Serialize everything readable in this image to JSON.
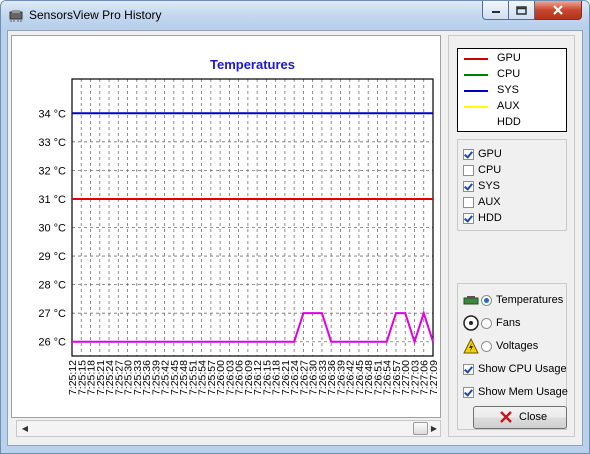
{
  "window": {
    "title": "SensorsView Pro History"
  },
  "chart_data": {
    "type": "line",
    "title": "Temperatures",
    "ylim": [
      25.5,
      35.2
    ],
    "y_ticks": [
      "26 °C",
      "27 °C",
      "28 °C",
      "29 °C",
      "30 °C",
      "31 °C",
      "32 °C",
      "33 °C",
      "34 °C"
    ],
    "y_tick_values": [
      26,
      27,
      28,
      29,
      30,
      31,
      32,
      33,
      34
    ],
    "x_categories": [
      "7:25:12",
      "7:25:15",
      "7:25:18",
      "7:25:21",
      "7:25:24",
      "7:25:27",
      "7:25:30",
      "7:25:33",
      "7:25:36",
      "7:25:39",
      "7:25:42",
      "7:25:45",
      "7:25:48",
      "7:25:51",
      "7:25:54",
      "7:25:57",
      "7:26:00",
      "7:26:03",
      "7:26:06",
      "7:26:09",
      "7:26:12",
      "7:26:15",
      "7:26:18",
      "7:26:21",
      "7:26:24",
      "7:26:27",
      "7:26:30",
      "7:26:33",
      "7:26:36",
      "7:26:39",
      "7:26:42",
      "7:26:45",
      "7:26:48",
      "7:26:51",
      "7:26:54",
      "7:26:57",
      "7:27:00",
      "7:27:03",
      "7:27:06",
      "7:27:09"
    ],
    "grid": true,
    "series": [
      {
        "name": "SYS",
        "color": "#0000c0",
        "values": [
          34,
          34,
          34,
          34,
          34,
          34,
          34,
          34,
          34,
          34,
          34,
          34,
          34,
          34,
          34,
          34,
          34,
          34,
          34,
          34,
          34,
          34,
          34,
          34,
          34,
          34,
          34,
          34,
          34,
          34,
          34,
          34,
          34,
          34,
          34,
          34,
          34,
          34,
          34,
          34
        ]
      },
      {
        "name": "GPU",
        "color": "#e00000",
        "values": [
          31,
          31,
          31,
          31,
          31,
          31,
          31,
          31,
          31,
          31,
          31,
          31,
          31,
          31,
          31,
          31,
          31,
          31,
          31,
          31,
          31,
          31,
          31,
          31,
          31,
          31,
          31,
          31,
          31,
          31,
          31,
          31,
          31,
          31,
          31,
          31,
          31,
          31,
          31,
          31
        ]
      },
      {
        "name": "HDD",
        "color": "#e000e0",
        "values": [
          26,
          26,
          26,
          26,
          26,
          26,
          26,
          26,
          26,
          26,
          26,
          26,
          26,
          26,
          26,
          26,
          26,
          26,
          26,
          26,
          26,
          26,
          26,
          26,
          26,
          27,
          27,
          27,
          26,
          26,
          26,
          26,
          26,
          26,
          26,
          27,
          27,
          26,
          27,
          26
        ]
      }
    ]
  },
  "legend": [
    {
      "label": "GPU",
      "color": "#d00000"
    },
    {
      "label": "CPU",
      "color": "#008000"
    },
    {
      "label": "SYS",
      "color": "#0000c0"
    },
    {
      "label": "AUX",
      "color": "#ffff00"
    },
    {
      "label": "HDD",
      "color": "#ffffff"
    }
  ],
  "checkboxes": [
    {
      "label": "GPU",
      "checked": true
    },
    {
      "label": "CPU",
      "checked": false
    },
    {
      "label": "SYS",
      "checked": true
    },
    {
      "label": "AUX",
      "checked": false
    },
    {
      "label": "HDD",
      "checked": true
    }
  ],
  "options": {
    "temperatures": "Temperatures",
    "fans": "Fans",
    "voltages": "Voltages",
    "selected": "temperatures"
  },
  "toggles": [
    {
      "label": "Show CPU Usage",
      "checked": true
    },
    {
      "label": "Show Mem Usage",
      "checked": true
    }
  ],
  "close_label": "Close"
}
